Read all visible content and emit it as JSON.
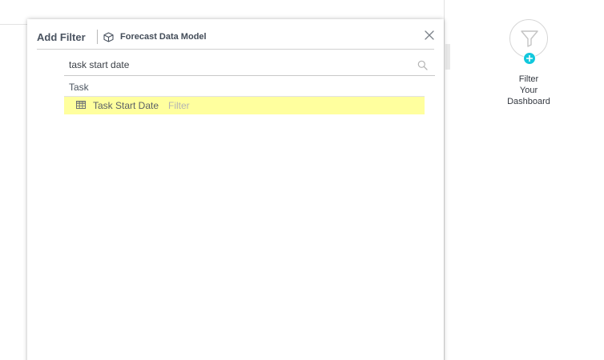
{
  "dialog": {
    "title": "Add Filter",
    "model_name": "Forecast Data Model"
  },
  "search": {
    "value": "task start date",
    "placeholder": ""
  },
  "results": {
    "group_label": "Task",
    "items": [
      {
        "name": "Task Start Date",
        "type": "Filter",
        "highlighted": true
      }
    ]
  },
  "widget": {
    "label_line1": "Filter",
    "label_line2": "Your",
    "label_line3": "Dashboard"
  },
  "icons": {
    "close": "close-icon",
    "search": "search-icon",
    "model": "cube-icon",
    "table": "table-icon",
    "funnel": "funnel-icon",
    "plus": "plus-icon"
  },
  "colors": {
    "highlight": "#ffff9e",
    "accent": "#12c8dd",
    "title": "#4a5360"
  }
}
